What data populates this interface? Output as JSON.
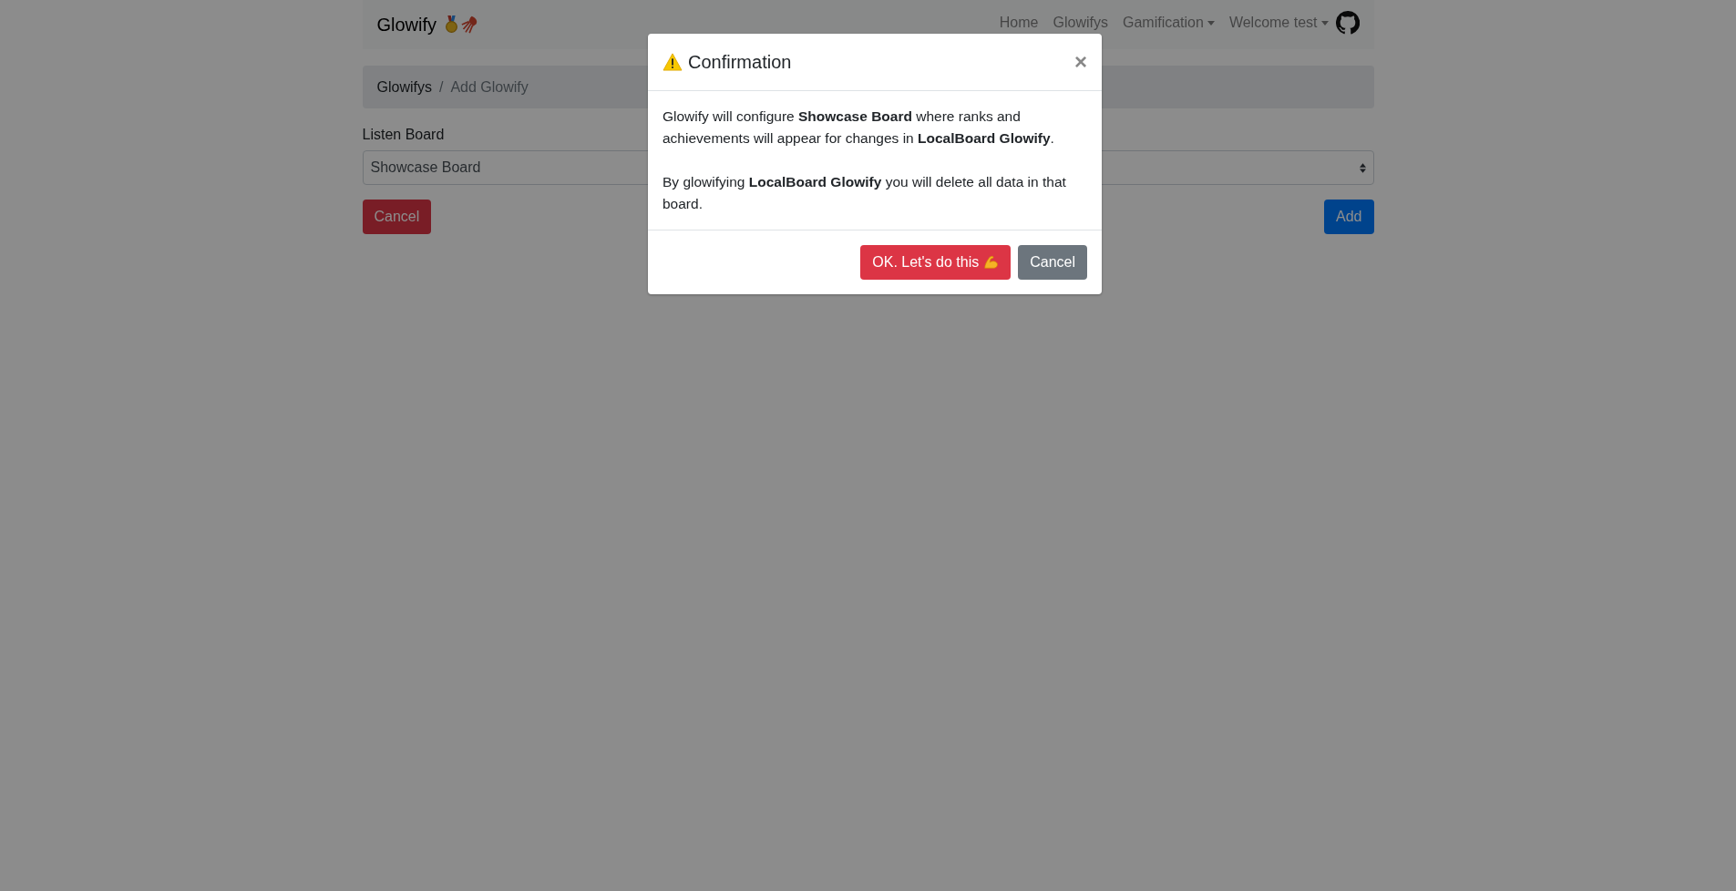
{
  "navbar": {
    "brand": "Glowify",
    "links": [
      {
        "label": "Home",
        "dropdown": false
      },
      {
        "label": "Glowifys",
        "dropdown": false
      },
      {
        "label": "Gamification",
        "dropdown": true
      },
      {
        "label": "Welcome test",
        "dropdown": true
      }
    ]
  },
  "breadcrumb": {
    "separator": "/",
    "items": [
      {
        "label": "Glowifys",
        "active": false
      },
      {
        "label": "Add Glowify",
        "active": true
      }
    ]
  },
  "form": {
    "label": "Listen Board",
    "value": "Showcase Board"
  },
  "buttons": [
    {
      "label": "Cancel",
      "kind": "danger"
    },
    {
      "label": "Add",
      "kind": "primary"
    }
  ],
  "modal": {
    "title": "Confirmation",
    "close": "×",
    "paragraphs": [
      "Glowify will configure **Showcase Board** where ranks and achievements will appear for changes in **LocalBoard Glowify**.",
      "By glowifying **LocalBoard Glowify** you will delete all data in that board."
    ],
    "buttons": [
      {
        "label": "OK. Let's do this",
        "kind": "danger"
      },
      {
        "label": "Cancel",
        "kind": "secondary"
      }
    ]
  }
}
